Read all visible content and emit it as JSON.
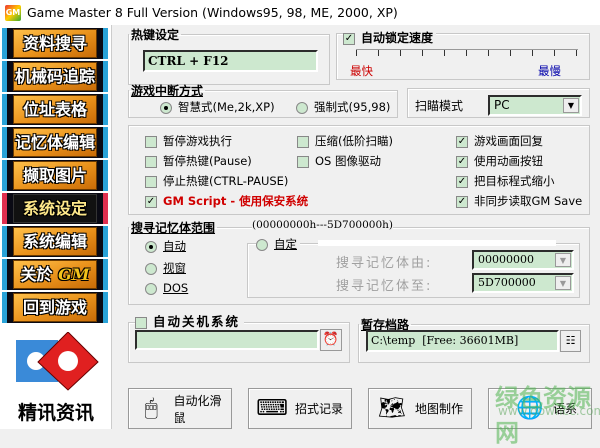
{
  "window": {
    "title": "Game Master 8 Full Version (Windows95, 98, ME, 2000, XP)",
    "icon": "GM"
  },
  "sidebar": {
    "items": [
      {
        "label": "资料搜寻"
      },
      {
        "label": "机械码追踪"
      },
      {
        "label": "位址表格"
      },
      {
        "label": "记忆体编辑"
      },
      {
        "label": "撷取图片"
      },
      {
        "label": "系统设定",
        "active": true
      },
      {
        "label": "系统编辑"
      },
      {
        "label": "关於",
        "badge": "GM"
      },
      {
        "label": "回到游戏"
      }
    ],
    "logo_text": "精讯资讯"
  },
  "hotkey": {
    "legend": "热键设定",
    "value": "CTRL + F12"
  },
  "speed": {
    "label": "自动锁定速度",
    "checked": true,
    "fast": "最快",
    "slow": "最慢",
    "fast_color": "#cc0000",
    "slow_color": "#0000aa"
  },
  "interrupt": {
    "legend": "游戏中断方式",
    "options": [
      {
        "label": "智慧式(Me,2k,XP)",
        "selected": true
      },
      {
        "label": "强制式(95,98)",
        "selected": false
      }
    ]
  },
  "scan_mode": {
    "label": "扫瞄模式",
    "value": "PC"
  },
  "options": {
    "col1": [
      {
        "label": "暂停游戏执行",
        "checked": false
      },
      {
        "label": "暂停热键(Pause)",
        "checked": false
      },
      {
        "label": "停止热键(CTRL-PAUSE)",
        "checked": false
      },
      {
        "label": "GM Script - 使用保安系统",
        "checked": true
      }
    ],
    "col2": [
      {
        "label": "压缩(低阶扫瞄)",
        "checked": false
      },
      {
        "label": "OS 图像驱动",
        "checked": false
      }
    ],
    "col3": [
      {
        "label": "游戏画面回复",
        "checked": true
      },
      {
        "label": "使用动画按钮",
        "checked": true
      },
      {
        "label": "把目标程式缩小",
        "checked": true
      },
      {
        "label": "非同步读取GM Save",
        "checked": true
      }
    ]
  },
  "memory_range": {
    "legend": "搜寻记忆体范围",
    "range": "(00000000h---5D700000h)",
    "options": [
      {
        "label": "自动",
        "selected": true
      },
      {
        "label": "视窗",
        "selected": false
      },
      {
        "label": "DOS",
        "selected": false
      }
    ],
    "custom": {
      "label": "自定",
      "from_label": "搜寻记忆体由:",
      "from_value": "00000000",
      "to_label": "搜寻记忆体至:",
      "to_value": "5D700000"
    }
  },
  "shutdown": {
    "label": "自动关机系统",
    "checked": false,
    "value": ""
  },
  "temp_path": {
    "legend": "暂存档路",
    "value": "C:\\temp  [Free: 36601MB]"
  },
  "buttons": [
    {
      "label": "自动化滑鼠",
      "icon": "mouse-icon"
    },
    {
      "label": "招式记录",
      "icon": "keyboard-icon"
    },
    {
      "label": "地图制作",
      "icon": "map-icon"
    },
    {
      "label": "语系",
      "icon": "globe-icon"
    }
  ],
  "watermark": {
    "text": "绿色资源网",
    "url": "www.downcc.com"
  }
}
